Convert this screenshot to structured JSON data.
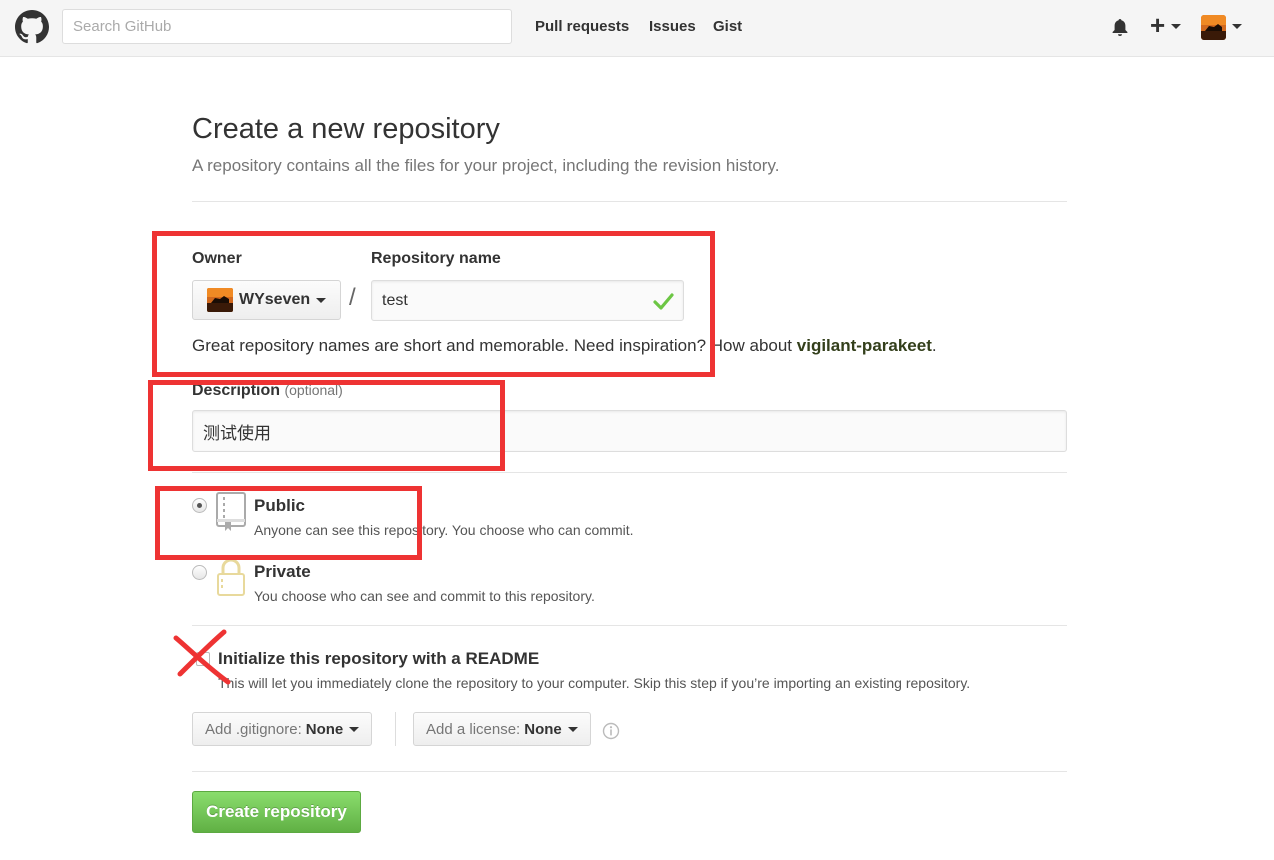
{
  "header": {
    "search_placeholder": "Search GitHub",
    "nav": [
      {
        "label": "Pull requests"
      },
      {
        "label": "Issues"
      },
      {
        "label": "Gist"
      }
    ]
  },
  "page": {
    "title": "Create a new repository",
    "subtitle": "A repository contains all the files for your project, including the revision history."
  },
  "form": {
    "owner_label": "Owner",
    "owner_value": "WYseven",
    "separator": "/",
    "repo_name_label": "Repository name",
    "repo_name_value": "test",
    "hint_prefix": "Great repository names are short and memorable. Need inspiration? How about ",
    "hint_suggestion": "vigilant-parakeet",
    "hint_suffix": ".",
    "description_label": "Description",
    "description_optional": "(optional)",
    "description_value": "测试使用",
    "visibility": {
      "public_title": "Public",
      "public_desc": "Anyone can see this repository. You choose who can commit.",
      "private_title": "Private",
      "private_desc": "You choose who can see and commit to this repository.",
      "selected": "public"
    },
    "readme_title": "Initialize this repository with a README",
    "readme_desc": "This will let you immediately clone the repository to your computer. Skip this step if you’re importing an existing repository.",
    "readme_checked": false,
    "gitignore_label": "Add .gitignore:",
    "gitignore_value": "None",
    "license_label": "Add a license:",
    "license_value": "None",
    "submit_label": "Create repository"
  },
  "colors": {
    "annotation": "#ee3333",
    "submit_green": "#60b044",
    "suggestion": "#333f1b",
    "check_green": "#6cc644"
  }
}
